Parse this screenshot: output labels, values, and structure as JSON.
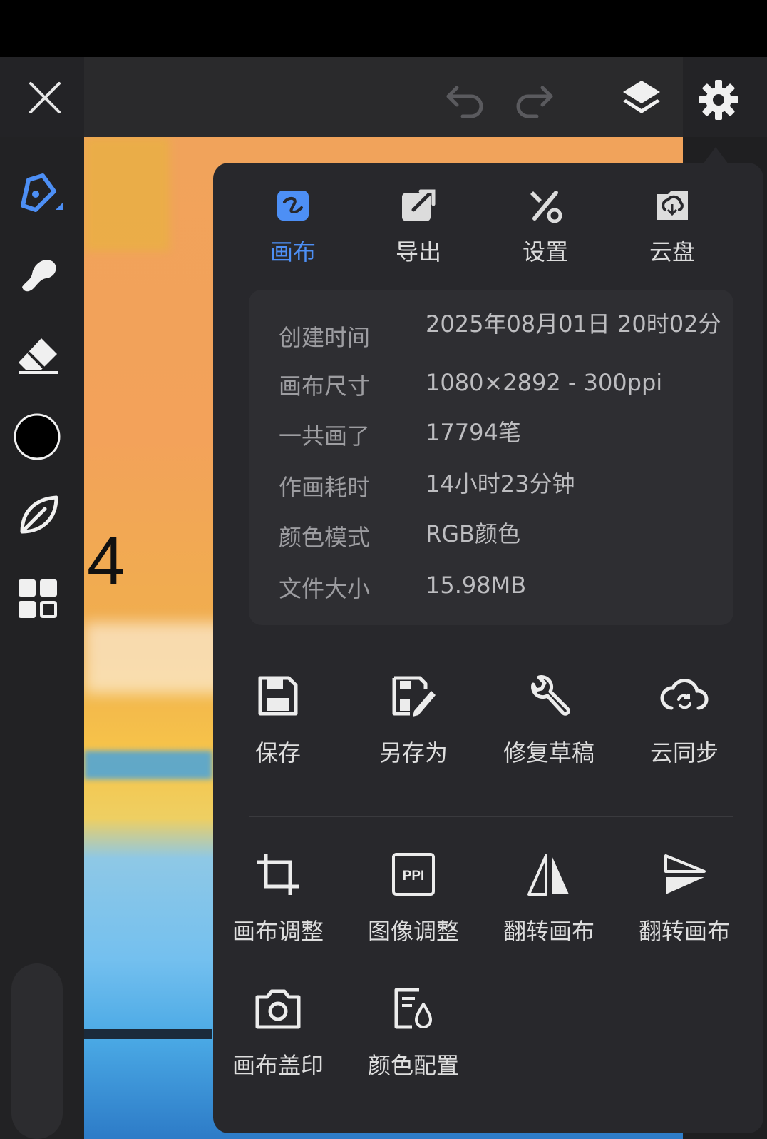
{
  "colors": {
    "accent": "#4d8ff5",
    "panel": "#28282c",
    "info_bg": "#2e2e32"
  },
  "toolbar": {
    "close_icon": "close-icon",
    "undo_icon": "undo-icon",
    "redo_icon": "redo-icon",
    "layers_icon": "layers-icon",
    "settings_icon": "gear-icon"
  },
  "sidebar": {
    "tools": [
      "brush-icon",
      "smudge-icon",
      "eraser-icon",
      "color-swatch",
      "leaf-icon",
      "grid-icon"
    ],
    "current_color": "#000000"
  },
  "canvas": {
    "digit": "4"
  },
  "panel": {
    "tabs": [
      {
        "label": "画布",
        "icon": "canvas-icon",
        "active": true
      },
      {
        "label": "导出",
        "icon": "export-icon",
        "active": false
      },
      {
        "label": "设置",
        "icon": "tools-icon",
        "active": false
      },
      {
        "label": "云盘",
        "icon": "cloud-drive-icon",
        "active": false
      }
    ],
    "info": [
      {
        "key": "创建时间",
        "value": "2025年08月01日 20时02分"
      },
      {
        "key": "画布尺寸",
        "value": "1080×2892 - 300ppi"
      },
      {
        "key": "一共画了",
        "value": "17794笔"
      },
      {
        "key": "作画耗时",
        "value": "14小时23分钟"
      },
      {
        "key": "颜色模式",
        "value": "RGB颜色"
      },
      {
        "key": "文件大小",
        "value": "15.98MB"
      }
    ],
    "actions_row1": [
      {
        "label": "保存",
        "icon": "save-icon"
      },
      {
        "label": "另存为",
        "icon": "save-as-icon"
      },
      {
        "label": "修复草稿",
        "icon": "wrench-icon"
      },
      {
        "label": "云同步",
        "icon": "cloud-sync-icon"
      }
    ],
    "actions_row2": [
      {
        "label": "画布调整",
        "icon": "crop-icon"
      },
      {
        "label": "图像调整",
        "icon": "ppi-icon"
      },
      {
        "label": "翻转画布",
        "icon": "flip-horizontal-icon"
      },
      {
        "label": "翻转画布",
        "icon": "flip-vertical-icon"
      }
    ],
    "actions_row3": [
      {
        "label": "画布盖印",
        "icon": "camera-icon"
      },
      {
        "label": "颜色配置",
        "icon": "color-profile-icon"
      }
    ]
  }
}
